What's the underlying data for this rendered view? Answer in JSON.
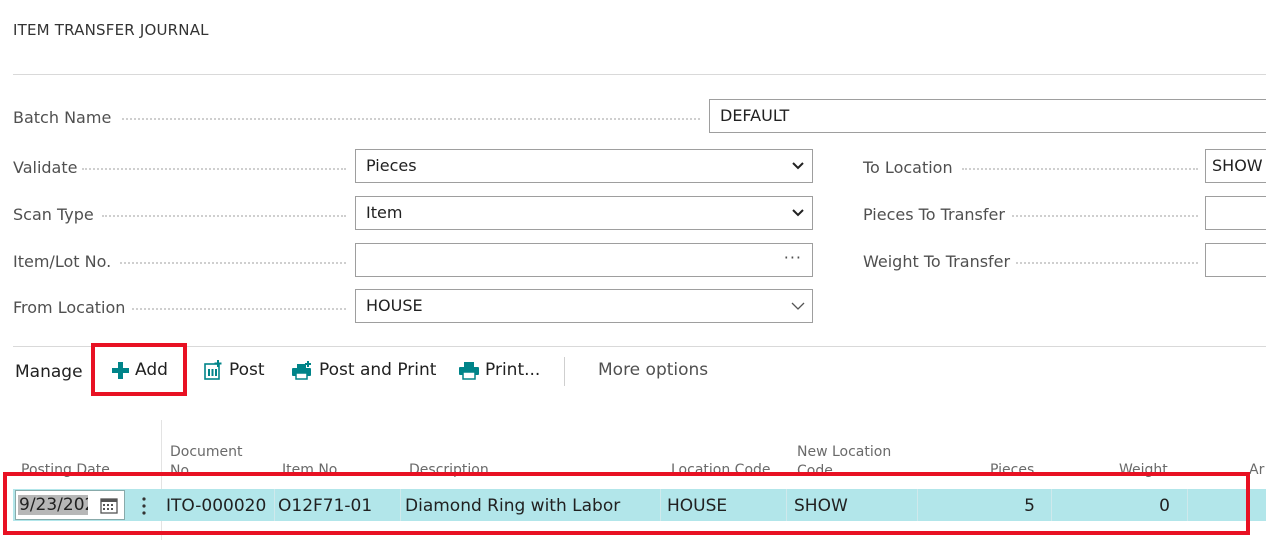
{
  "page": {
    "title": "ITEM TRANSFER JOURNAL"
  },
  "fields": {
    "batch_name": {
      "label": "Batch Name",
      "value": "DEFAULT"
    },
    "validate": {
      "label": "Validate",
      "value": "Pieces"
    },
    "scan_type": {
      "label": "Scan Type",
      "value": "Item"
    },
    "item_lot_no": {
      "label": "Item/Lot No.",
      "value": "",
      "lookup": "···"
    },
    "from_location": {
      "label": "From Location",
      "value": "HOUSE"
    },
    "to_location": {
      "label": "To Location",
      "value": "SHOW"
    },
    "pieces_to_transfer": {
      "label": "Pieces To Transfer",
      "value": ""
    },
    "weight_to_transfer": {
      "label": "Weight To Transfer",
      "value": ""
    }
  },
  "toolbar": {
    "manage": "Manage",
    "add": "Add",
    "post": "Post",
    "post_and_print": "Post and Print",
    "print": "Print...",
    "more_options": "More options"
  },
  "table": {
    "headers": {
      "posting_date": "Posting Date",
      "document_no_1": "Document",
      "document_no_2": "No.",
      "item_no": "Item No.",
      "description": "Description",
      "location_code": "Location Code",
      "new_location_code_1": "New Location",
      "new_location_code_2": "Code",
      "pieces": "Pieces",
      "weight": "Weight",
      "truncated": "Ar"
    },
    "rows": [
      {
        "posting_date": "9/23/202",
        "document_no": "ITO-000020",
        "item_no": "O12F71-01",
        "description": "Diamond Ring with Labor",
        "location_code": "HOUSE",
        "new_location_code": "SHOW",
        "pieces": "5",
        "weight": "0"
      }
    ]
  },
  "icons": {
    "add": "plus-icon",
    "post": "post-icon",
    "post_and_print": "post-print-icon",
    "print": "print-icon",
    "calendar": "calendar-icon",
    "chevron": "chevron-down-icon",
    "row_menu": "vertical-ellipsis-icon"
  },
  "colors": {
    "accent": "#008489",
    "selected_row": "#b2e6ea",
    "highlight_box": "#e81123"
  }
}
